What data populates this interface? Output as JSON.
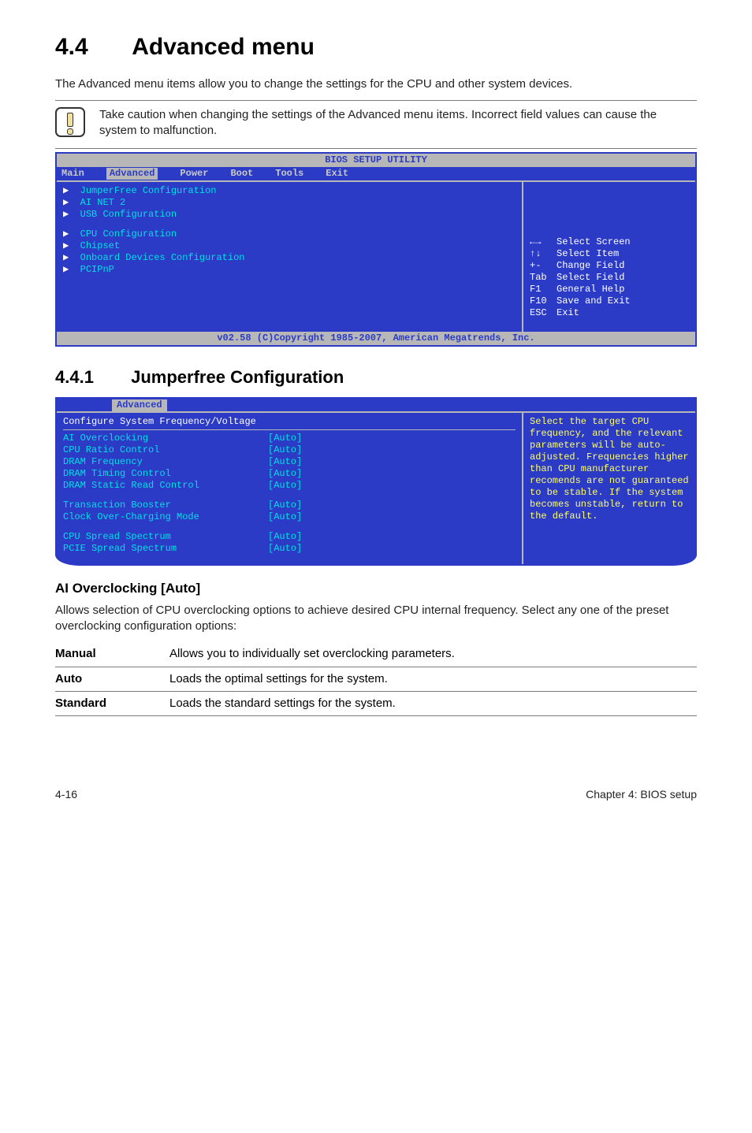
{
  "section": {
    "number": "4.4",
    "title": "Advanced menu"
  },
  "intro": "The Advanced menu items allow you to change the settings for the CPU and other system devices.",
  "caution": "Take caution when changing the settings of the Advanced menu items. Incorrect field values can cause the system to malfunction.",
  "bios1": {
    "title": "BIOS SETUP UTILITY",
    "tabs": [
      "Main",
      "Advanced",
      "Power",
      "Boot",
      "Tools",
      "Exit"
    ],
    "active_tab": "Advanced",
    "menu_group1": [
      "JumperFree Configuration",
      "AI NET 2",
      "USB Configuration"
    ],
    "menu_group2": [
      "CPU Configuration",
      "Chipset",
      "Onboard Devices Configuration",
      "PCIPnP"
    ],
    "help": [
      {
        "key": "←→",
        "text": "Select Screen"
      },
      {
        "key": "↑↓",
        "text": "Select Item"
      },
      {
        "key": "+-",
        "text": "Change Field"
      },
      {
        "key": "Tab",
        "text": "Select Field"
      },
      {
        "key": "F1",
        "text": "General Help"
      },
      {
        "key": "F10",
        "text": "Save and Exit"
      },
      {
        "key": "ESC",
        "text": "Exit"
      }
    ],
    "footer": "v02.58 (C)Copyright 1985-2007, American Megatrends, Inc."
  },
  "subsection": {
    "number": "4.4.1",
    "title": "Jumperfree Configuration"
  },
  "bios2": {
    "tab_label": "Advanced",
    "panel_title": "Configure System Frequency/Voltage",
    "rows_group1": [
      {
        "label": "AI Overclocking",
        "value": "[Auto]"
      },
      {
        "label": "CPU Ratio Control",
        "value": "[Auto]"
      },
      {
        "label": "DRAM Frequency",
        "value": "[Auto]"
      },
      {
        "label": "DRAM Timing Control",
        "value": "[Auto]"
      },
      {
        "label": "DRAM Static Read Control",
        "value": "[Auto]"
      }
    ],
    "rows_group2": [
      {
        "label": "Transaction Booster",
        "value": "[Auto]"
      },
      {
        "label": "Clock Over-Charging Mode",
        "value": "[Auto]"
      }
    ],
    "rows_group3": [
      {
        "label": "CPU Spread Spectrum",
        "value": "[Auto]"
      },
      {
        "label": "PCIE Spread Spectrum",
        "value": "[Auto]"
      }
    ],
    "help_text": "Select the target CPU frequency, and the relevant parameters will be auto-adjusted. Frequencies higher than CPU manufacturer recomends are not guaranteed to be stable. If the system becomes unstable, return to the default."
  },
  "ai_heading": "AI Overclocking [Auto]",
  "ai_text": "Allows selection of CPU overclocking options to achieve desired CPU internal frequency. Select any one of the preset overclocking configuration options:",
  "params": [
    {
      "k": "Manual",
      "v": "Allows you to individually set overclocking parameters."
    },
    {
      "k": "Auto",
      "v": "Loads the optimal settings for the system."
    },
    {
      "k": "Standard",
      "v": "Loads the standard settings for the system."
    }
  ],
  "footer": {
    "left": "4-16",
    "right": "Chapter 4: BIOS setup"
  }
}
